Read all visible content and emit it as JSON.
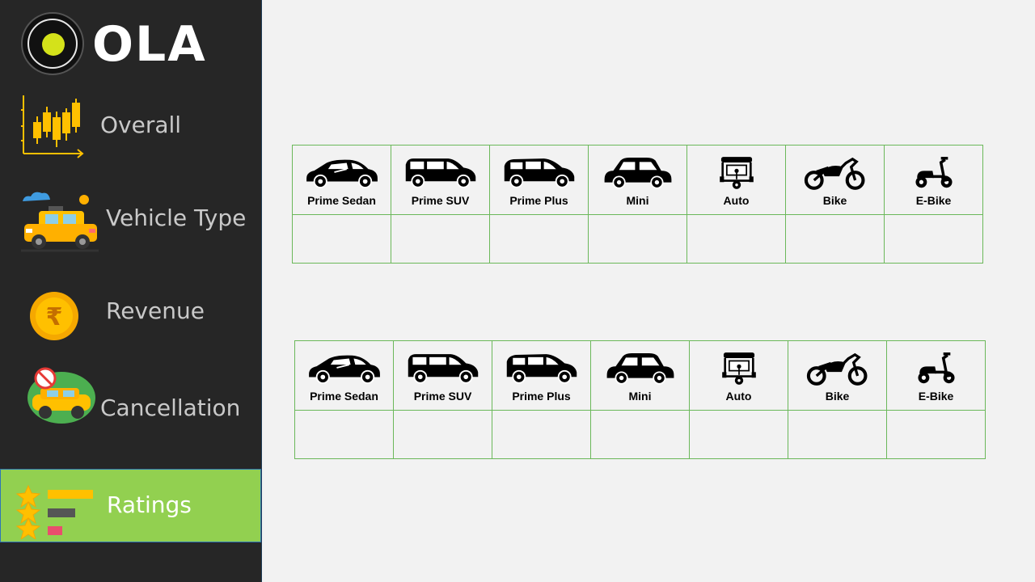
{
  "brand": {
    "name": "OLA"
  },
  "nav": [
    {
      "label": "Overall",
      "icon": "candlestick-chart-icon",
      "active": false
    },
    {
      "label": "Vehicle Type",
      "icon": "taxi-car-icon",
      "active": false
    },
    {
      "label": "Revenue",
      "icon": "rupee-coin-icon",
      "active": false
    },
    {
      "label": "Cancellation",
      "icon": "cancelled-ride-icon",
      "active": false
    },
    {
      "label": "Ratings",
      "icon": "star-ratings-icon",
      "active": true
    }
  ],
  "tables": [
    {
      "vehicles": [
        {
          "label": "Prime Sedan",
          "icon": "sedan-icon",
          "value": ""
        },
        {
          "label": "Prime SUV",
          "icon": "suv-icon",
          "value": ""
        },
        {
          "label": "Prime Plus",
          "icon": "hatchback-icon",
          "value": ""
        },
        {
          "label": "Mini",
          "icon": "mini-car-icon",
          "value": ""
        },
        {
          "label": "Auto",
          "icon": "auto-rickshaw-icon",
          "value": ""
        },
        {
          "label": "Bike",
          "icon": "motorcycle-icon",
          "value": ""
        },
        {
          "label": "E-Bike",
          "icon": "scooter-icon",
          "value": ""
        }
      ]
    },
    {
      "vehicles": [
        {
          "label": "Prime Sedan",
          "icon": "sedan-icon",
          "value": ""
        },
        {
          "label": "Prime SUV",
          "icon": "suv-icon",
          "value": ""
        },
        {
          "label": "Prime Plus",
          "icon": "hatchback-icon",
          "value": ""
        },
        {
          "label": "Mini",
          "icon": "mini-car-icon",
          "value": ""
        },
        {
          "label": "Auto",
          "icon": "auto-rickshaw-icon",
          "value": ""
        },
        {
          "label": "Bike",
          "icon": "motorcycle-icon",
          "value": ""
        },
        {
          "label": "E-Bike",
          "icon": "scooter-icon",
          "value": ""
        }
      ]
    }
  ],
  "colors": {
    "sidebar_bg": "#262626",
    "active_bg": "#92d050",
    "grid_border": "#6bb85a",
    "page_bg": "#f2f2f2"
  }
}
